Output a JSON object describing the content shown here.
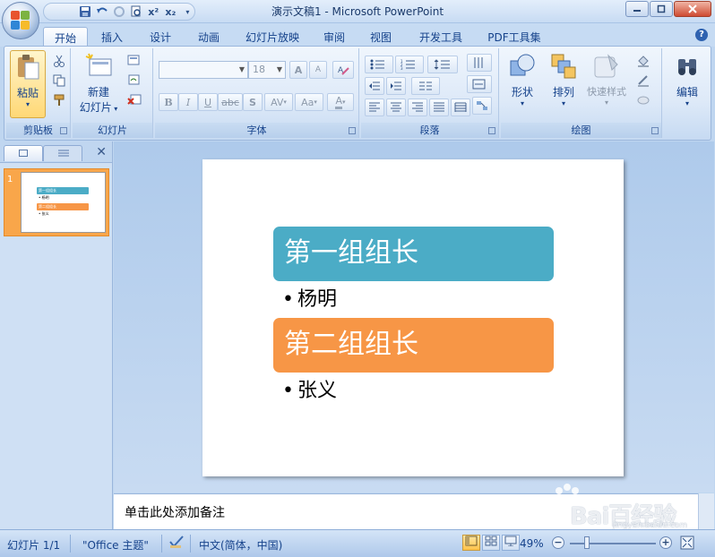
{
  "window": {
    "title": "演示文稿1 - Microsoft PowerPoint"
  },
  "qat": {
    "items": [
      "save-icon",
      "undo-icon",
      "redo-icon",
      "print-preview-icon",
      "superscript-icon",
      "subscript-icon",
      "customize-icon"
    ],
    "superscript_label": "x²",
    "subscript_label": "x₂"
  },
  "tabs": [
    {
      "label": "开始",
      "active": true
    },
    {
      "label": "插入"
    },
    {
      "label": "设计"
    },
    {
      "label": "动画"
    },
    {
      "label": "幻灯片放映"
    },
    {
      "label": "审阅"
    },
    {
      "label": "视图"
    },
    {
      "label": "开发工具"
    },
    {
      "label": "PDF工具集"
    }
  ],
  "ribbon": {
    "clipboard": {
      "label": "剪贴板",
      "paste": "粘贴"
    },
    "slides": {
      "label": "幻灯片",
      "new_slide_line1": "新建",
      "new_slide_line2": "幻灯片"
    },
    "font": {
      "label": "字体",
      "size": "18",
      "bold": "B",
      "italic": "I",
      "underline": "U",
      "strike": "abc",
      "shadow": "S",
      "spacing": "AV",
      "case": "Aa",
      "color": "A",
      "grow": "A",
      "shrink": "A"
    },
    "paragraph": {
      "label": "段落"
    },
    "drawing": {
      "label": "绘图",
      "shapes": "形状",
      "arrange": "排列",
      "quick_styles": "快速样式"
    },
    "editing": {
      "label": "编辑"
    }
  },
  "slide": {
    "number": "1",
    "sections": [
      {
        "header": "第一组组长",
        "bullet": "杨明",
        "color": "#4bacc6"
      },
      {
        "header": "第二组组长",
        "bullet": "张义",
        "color": "#f79646"
      }
    ]
  },
  "notes": {
    "placeholder": "单击此处添加备注"
  },
  "status": {
    "slide_info": "幻灯片 1/1",
    "theme": "\"Office 主题\"",
    "language": "中文(简体，中国)",
    "zoom": "49%",
    "zoom_minus": "−",
    "zoom_plus": "+"
  },
  "watermark": {
    "text": "Bai百经验",
    "sub": "jingyan.baidu.com"
  }
}
